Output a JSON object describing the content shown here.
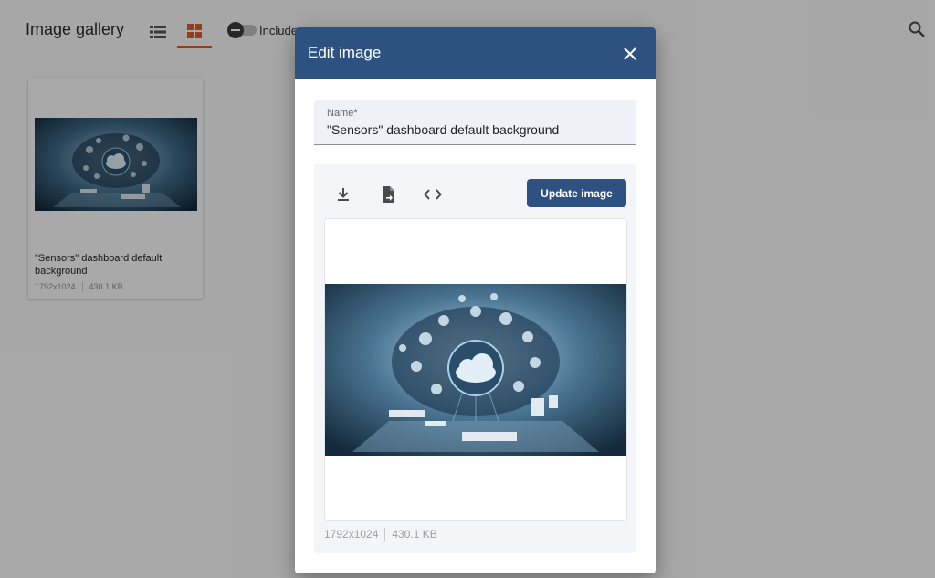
{
  "page": {
    "title": "Image gallery",
    "toggle_label": "Include",
    "accent_color": "#e05a25"
  },
  "icons": {
    "list_view": "list-icon",
    "grid_view": "grid-icon",
    "search": "search-icon"
  },
  "gallery": {
    "items": [
      {
        "name": "\"Sensors\" dashboard default background",
        "dimensions": "1792x1024",
        "size": "430.1 KB"
      }
    ]
  },
  "dialog": {
    "title": "Edit image",
    "header_color": "#2d5282",
    "name_label": "Name*",
    "name_value": "\"Sensors\" dashboard default background",
    "update_button": "Update image",
    "dimensions": "1792x1024",
    "size": "430.1 KB",
    "toolbar_icons": [
      "download-icon",
      "file-export-icon",
      "code-icon"
    ]
  }
}
